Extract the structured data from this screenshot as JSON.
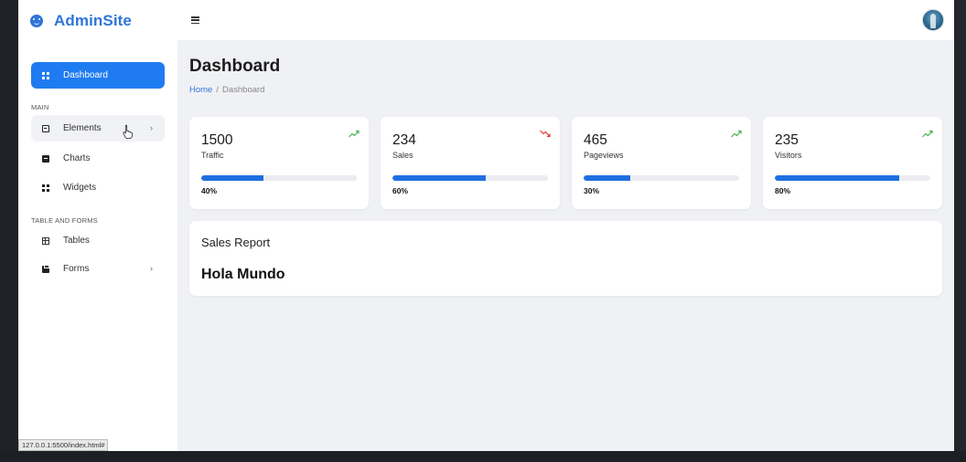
{
  "brand": {
    "name": "AdminSite",
    "icon": "smiley-icon",
    "color": "#2f74d8"
  },
  "sidebar": {
    "sections": [
      "MAIN",
      "TABLE AND FORMS"
    ],
    "items": [
      {
        "label": "Dashboard",
        "icon": "grid-icon",
        "active": true
      },
      {
        "label": "Elements",
        "icon": "inbox-icon",
        "chevron": "›"
      },
      {
        "label": "Charts",
        "icon": "chart-icon"
      },
      {
        "label": "Widgets",
        "icon": "widgets-icon"
      },
      {
        "label": "Tables",
        "icon": "table-icon"
      },
      {
        "label": "Forms",
        "icon": "form-icon",
        "chevron": "›"
      }
    ]
  },
  "topbar": {
    "menu_icon": "hamburger-icon",
    "avatar": "user-avatar"
  },
  "main": {
    "title": "Dashboard",
    "breadcrumb": {
      "home": "Home",
      "separator": "/",
      "current": "Dashboard"
    },
    "stats": [
      {
        "value": "1500",
        "label": "Traffic",
        "percent_label": "40%",
        "progress": 0.4,
        "trend": "up",
        "trend_color": "#4caf50"
      },
      {
        "value": "234",
        "label": "Sales",
        "percent_label": "60%",
        "progress": 0.6,
        "trend": "down",
        "trend_color": "#e53935"
      },
      {
        "value": "465",
        "label": "Pageviews",
        "percent_label": "30%",
        "progress": 0.3,
        "trend": "up",
        "trend_color": "#4caf50"
      },
      {
        "value": "235",
        "label": "Visitors",
        "percent_label": "80%",
        "progress": 0.8,
        "trend": "up",
        "trend_color": "#4caf50"
      }
    ],
    "report": {
      "title": "Sales Report",
      "body": "Hola Mundo"
    }
  },
  "status_bar": {
    "url": "127.0.0.1:5500/index.html#"
  },
  "colors": {
    "accent": "#1f7cf0",
    "progress": "#1f6fe0",
    "background": "#f0f1f5"
  }
}
